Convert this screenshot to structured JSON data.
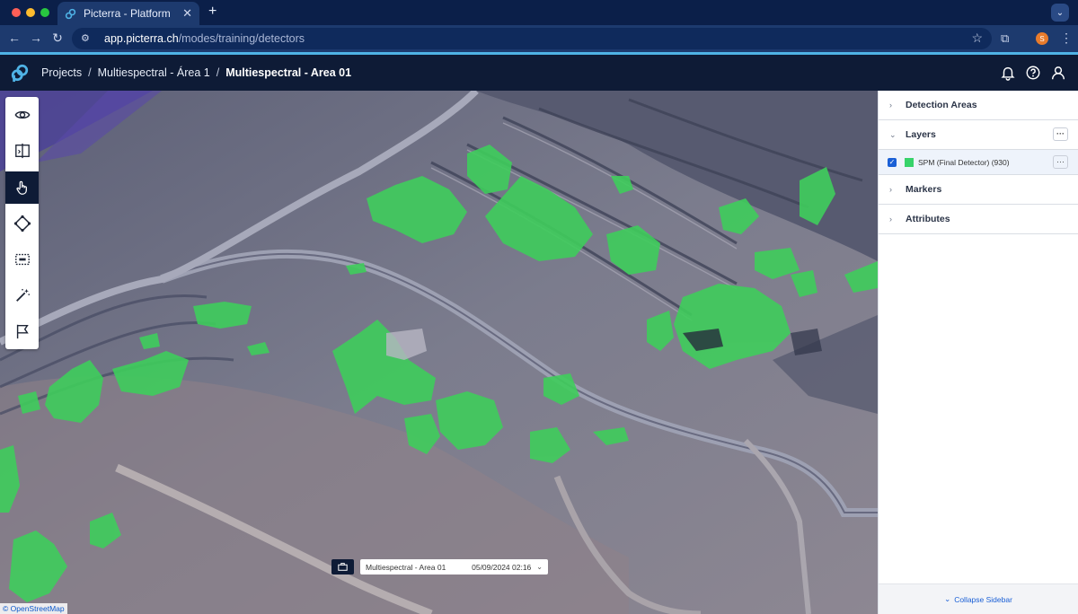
{
  "browser": {
    "tab_title": "Picterra - Platform",
    "new_tab": "+",
    "url_domain": "app.picterra.ch",
    "url_path": "/modes/training/detectors",
    "profile_initial": "S"
  },
  "header": {
    "breadcrumbs": [
      "Projects",
      "Multiespectral - Área 1",
      "Multiespectral - Area 01"
    ],
    "separator": "/"
  },
  "icons": {
    "header": [
      "bell-icon",
      "help-icon",
      "user-icon"
    ],
    "tools": [
      "eye-icon",
      "split-view-icon",
      "pan-hand-icon",
      "polygon-icon",
      "rectangle-select-icon",
      "magic-wand-icon",
      "flag-icon"
    ],
    "active_tool": "pan-hand-icon"
  },
  "map": {
    "date_select": {
      "name": "Multiespectral - Area 01",
      "date": "05/09/2024 02:16"
    },
    "attribution": "© OpenStreetMap"
  },
  "sidebar": {
    "sections": [
      {
        "label": "Detection Areas",
        "expanded": false
      },
      {
        "label": "Layers",
        "expanded": true
      },
      {
        "label": "Markers",
        "expanded": false
      },
      {
        "label": "Attributes",
        "expanded": false
      }
    ],
    "layers": [
      {
        "label": "SPM (Final Detector) (930)",
        "checked": true,
        "color": "#37d36a"
      }
    ],
    "more_label": "···",
    "collapse_label": "Collapse Sidebar"
  },
  "colors": {
    "app_header": "#0e1b36",
    "accent": "#4fb3e6",
    "detection_green": "#37d36a",
    "link_blue": "#1a5fd6"
  }
}
